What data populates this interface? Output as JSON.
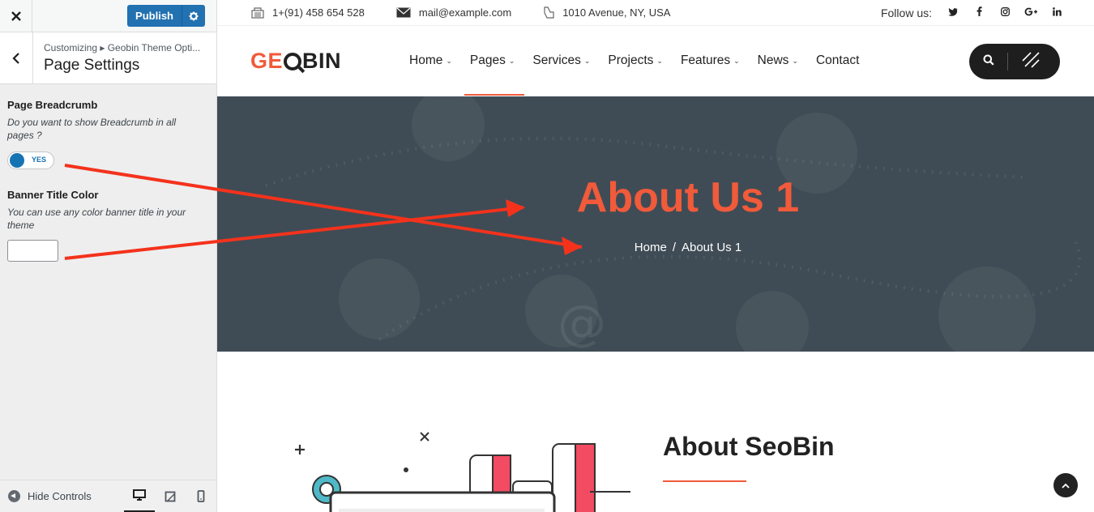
{
  "customizer": {
    "close_icon": "close-icon",
    "publish_label": "Publish",
    "breadcrumb": "Customizing ▸ Geobin Theme Opti...",
    "section_title": "Page Settings",
    "controls": {
      "breadcrumb_label": "Page Breadcrumb",
      "breadcrumb_desc": "Do you want to show Breadcrumb in all pages ?",
      "toggle_text": "YES",
      "color_label": "Banner Title Color",
      "color_desc": "You can use any color banner title in your theme",
      "color_value": ""
    },
    "footer": {
      "hide_label": "Hide Controls"
    }
  },
  "site": {
    "topbar": {
      "phone": "1+(91) 458 654 528",
      "email": "mail@example.com",
      "address": "1010 Avenue, NY, USA",
      "follow_label": "Follow us:",
      "social": [
        "twitter-icon",
        "facebook-icon",
        "instagram-icon",
        "google-plus-icon",
        "linkedin-icon"
      ]
    },
    "logo": {
      "part1": "GE",
      "part2": "BIN"
    },
    "menu": [
      "Home",
      "Pages",
      "Services",
      "Projects",
      "Features",
      "News",
      "Contact"
    ],
    "active_menu": "Pages",
    "banner": {
      "title": "About Us 1",
      "crumb_home": "Home",
      "crumb_sep": "/",
      "crumb_current": "About Us 1"
    },
    "about": {
      "title": "About SeoBin"
    }
  },
  "colors": {
    "accent": "#f15a3a",
    "publish": "#2271b1",
    "banner_bg": "#3f4c55",
    "annotation_arrow": "#f4321c"
  }
}
